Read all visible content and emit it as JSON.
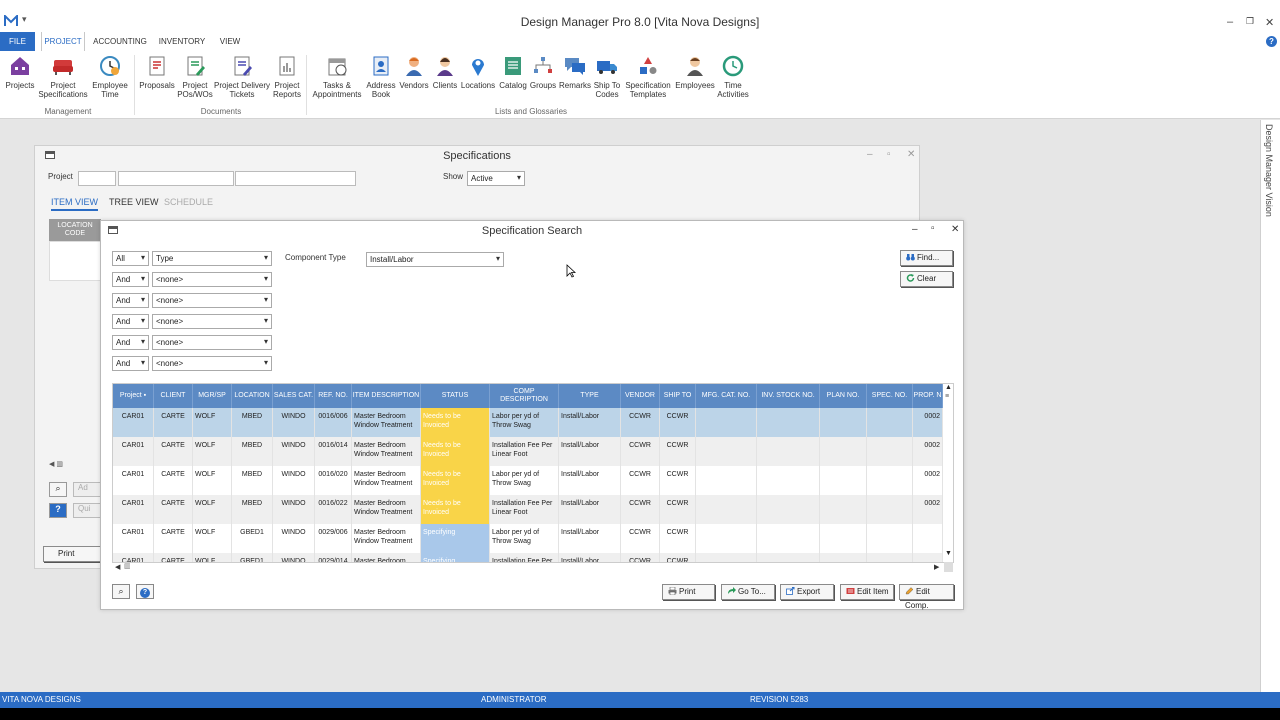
{
  "app": {
    "title": "Design Manager Pro 8.0 [Vita Nova Designs]",
    "window_controls": [
      "–",
      "❐",
      "✕"
    ]
  },
  "ribbon_tabs": [
    {
      "label": "FILE"
    },
    {
      "label": "PROJECT"
    },
    {
      "label": "ACCOUNTING"
    },
    {
      "label": "INVENTORY"
    },
    {
      "label": "VIEW"
    }
  ],
  "ribbon": {
    "groups": {
      "management": "Management",
      "documents": "Documents",
      "lists": "Lists and Glossaries"
    },
    "buttons": [
      {
        "label": "Projects",
        "icon": "house-icon"
      },
      {
        "label": "Project Specifications",
        "icon": "sofa-icon"
      },
      {
        "label": "Employee Time",
        "icon": "clock-icon"
      },
      {
        "label": "Proposals",
        "icon": "proposal-icon"
      },
      {
        "label": "Project POs/WOs",
        "icon": "purchase-order-icon"
      },
      {
        "label": "Project Delivery Tickets",
        "icon": "delivery-ticket-icon"
      },
      {
        "label": "Project Reports",
        "icon": "report-icon"
      },
      {
        "label": "Tasks & Appointments",
        "icon": "calendar-icon"
      },
      {
        "label": "Address Book",
        "icon": "address-book-icon"
      },
      {
        "label": "Vendors",
        "icon": "vendor-icon"
      },
      {
        "label": "Clients",
        "icon": "client-icon"
      },
      {
        "label": "Locations",
        "icon": "location-pin-icon"
      },
      {
        "label": "Catalog",
        "icon": "catalog-icon"
      },
      {
        "label": "Groups",
        "icon": "groups-icon"
      },
      {
        "label": "Remarks",
        "icon": "remarks-icon"
      },
      {
        "label": "Ship To Codes",
        "icon": "truck-icon"
      },
      {
        "label": "Specification Templates",
        "icon": "shapes-icon"
      },
      {
        "label": "Employees",
        "icon": "employee-icon"
      },
      {
        "label": "Time Activities",
        "icon": "time-activities-icon"
      }
    ]
  },
  "dock": {
    "vision_label": "Design Manager Vision"
  },
  "spec_window": {
    "title": "Specifications",
    "project_label": "Project",
    "show_label": "Show",
    "show_value": "Active",
    "tabs": [
      "ITEM VIEW",
      "TREE VIEW",
      "SCHEDULE"
    ],
    "location_code_header": "LOCATION CODE",
    "print_label": "Print",
    "partial_buttons": [
      "Ad",
      "Qui"
    ]
  },
  "search_window": {
    "title": "Specification Search",
    "component_type_label": "Component Type",
    "component_type_value": "Install/Labor",
    "find_label": "Find...",
    "clear_label": "Clear",
    "criteria": [
      {
        "op": "All",
        "field": "Type"
      },
      {
        "op": "And",
        "field": "<none>"
      },
      {
        "op": "And",
        "field": "<none>"
      },
      {
        "op": "And",
        "field": "<none>"
      },
      {
        "op": "And",
        "field": "<none>"
      },
      {
        "op": "And",
        "field": "<none>"
      }
    ],
    "columns": [
      "Project ▪",
      "CLIENT",
      "MGR/SP",
      "LOCATION",
      "SALES CAT.",
      "REF. NO.",
      "ITEM DESCRIPTION",
      "STATUS",
      "COMP DESCRIPTION",
      "TYPE",
      "VENDOR",
      "SHIP TO",
      "MFG. CAT. NO.",
      "INV. STOCK NO.",
      "PLAN NO.",
      "SPEC. NO.",
      "PROP. N"
    ],
    "rows": [
      {
        "project": "CAR01",
        "client": "CARTE",
        "mgr": "WOLF",
        "location": "MBED",
        "sales_cat": "WINDO",
        "ref": "0016/006",
        "item": "Master Bedroom Window Treatment",
        "status": "Needs to be Invoiced",
        "comp": "Labor per yd of Throw Swag",
        "type": "Install/Labor",
        "vendor": "CCWR",
        "ship_to": "CCWR",
        "prop": "0002"
      },
      {
        "project": "CAR01",
        "client": "CARTE",
        "mgr": "WOLF",
        "location": "MBED",
        "sales_cat": "WINDO",
        "ref": "0016/014",
        "item": "Master Bedroom Window Treatment",
        "status": "Needs to be Invoiced",
        "comp": "Installation Fee Per Linear Foot",
        "type": "Install/Labor",
        "vendor": "CCWR",
        "ship_to": "CCWR",
        "prop": "0002"
      },
      {
        "project": "CAR01",
        "client": "CARTE",
        "mgr": "WOLF",
        "location": "MBED",
        "sales_cat": "WINDO",
        "ref": "0016/020",
        "item": "Master Bedroom Window Treatment",
        "status": "Needs to be Invoiced",
        "comp": "Labor per yd of Throw Swag",
        "type": "Install/Labor",
        "vendor": "CCWR",
        "ship_to": "CCWR",
        "prop": "0002"
      },
      {
        "project": "CAR01",
        "client": "CARTE",
        "mgr": "WOLF",
        "location": "MBED",
        "sales_cat": "WINDO",
        "ref": "0016/022",
        "item": "Master Bedroom Window Treatment",
        "status": "Needs to be Invoiced",
        "comp": "Installation Fee Per Linear Foot",
        "type": "Install/Labor",
        "vendor": "CCWR",
        "ship_to": "CCWR",
        "prop": "0002"
      },
      {
        "project": "CAR01",
        "client": "CARTE",
        "mgr": "WOLF",
        "location": "GBED1",
        "sales_cat": "WINDO",
        "ref": "0029/006",
        "item": "Master Bedroom Window Treatment",
        "status": "Specifying",
        "comp": "Labor per yd of Throw Swag",
        "type": "Install/Labor",
        "vendor": "CCWR",
        "ship_to": "CCWR",
        "prop": ""
      },
      {
        "project": "CAR01",
        "client": "CARTE",
        "mgr": "WOLF",
        "location": "GBED1",
        "sales_cat": "WINDO",
        "ref": "0029/014",
        "item": "Master Bedroom Window Treatment",
        "status": "Specifying",
        "comp": "Installation Fee Per Linear Foot",
        "type": "Install/Labor",
        "vendor": "CCWR",
        "ship_to": "CCWR",
        "prop": ""
      }
    ],
    "bottom_buttons": [
      "Print",
      "Go To...",
      "Export",
      "Edit Item",
      "Edit Comp."
    ]
  },
  "colors": {
    "accent": "#2b6cc4",
    "header": "#5c8ac4",
    "status_invoiced": "#f9d448",
    "status_specifying": "#a9c8ea",
    "selected_row": "#bcd4e8",
    "alt_row": "#efefef"
  },
  "statusbar": {
    "company": "VITA NOVA DESIGNS",
    "user": "ADMINISTRATOR",
    "revision": "REVISION 5283"
  }
}
